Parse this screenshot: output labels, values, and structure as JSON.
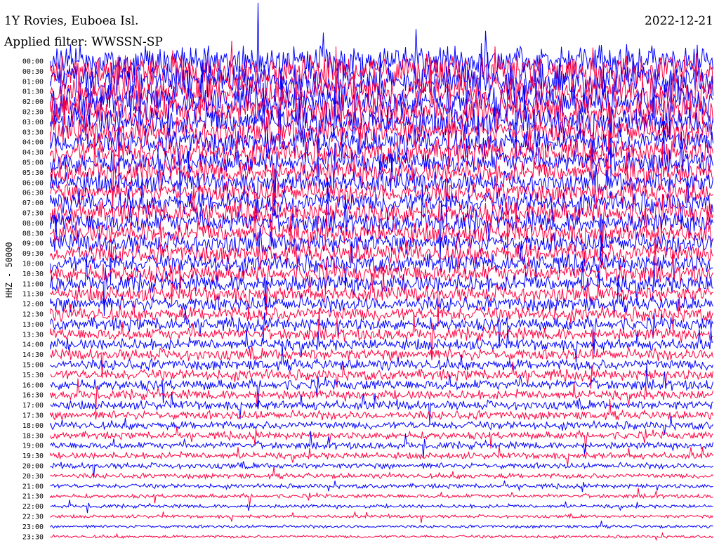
{
  "header": {
    "title": "1Y Rovies, Euboea Isl.",
    "date": "2022-12-21",
    "filter": "Applied filter: WWSSN-SP"
  },
  "chart_data": {
    "type": "line",
    "title": "1Y Rovies, Euboea Isl.",
    "ylabel": "HHZ - 50000",
    "rows": [
      "00:00",
      "00:30",
      "01:00",
      "01:30",
      "02:00",
      "02:30",
      "03:00",
      "03:30",
      "04:00",
      "04:30",
      "05:00",
      "05:30",
      "06:00",
      "06:30",
      "07:00",
      "07:30",
      "08:00",
      "08:30",
      "09:00",
      "09:30",
      "10:00",
      "10:30",
      "11:00",
      "11:30",
      "12:00",
      "12:30",
      "13:00",
      "13:30",
      "14:00",
      "14:30",
      "15:00",
      "15:30",
      "16:00",
      "16:30",
      "17:00",
      "17:30",
      "18:00",
      "18:30",
      "19:00",
      "19:30",
      "20:00",
      "20:30",
      "21:00",
      "21:30",
      "22:00",
      "22:30",
      "23:00",
      "23:30"
    ],
    "row_colors": [
      "#0000ff",
      "#ff0040"
    ],
    "noise_amplitude_rel": [
      4.2,
      4.4,
      4.6,
      4.4,
      4.5,
      4.3,
      4.1,
      3.8,
      3.6,
      3.4,
      3.2,
      3.1,
      3.0,
      3.0,
      3.1,
      3.1,
      3.0,
      2.9,
      2.8,
      2.8,
      2.6,
      2.5,
      2.4,
      2.2,
      2.1,
      2.0,
      1.8,
      1.7,
      1.6,
      1.6,
      1.5,
      1.5,
      1.4,
      1.3,
      1.25,
      1.2,
      1.1,
      1.0,
      0.95,
      0.9,
      0.8,
      0.7,
      0.62,
      0.55,
      0.5,
      0.45,
      0.42,
      0.4
    ]
  }
}
